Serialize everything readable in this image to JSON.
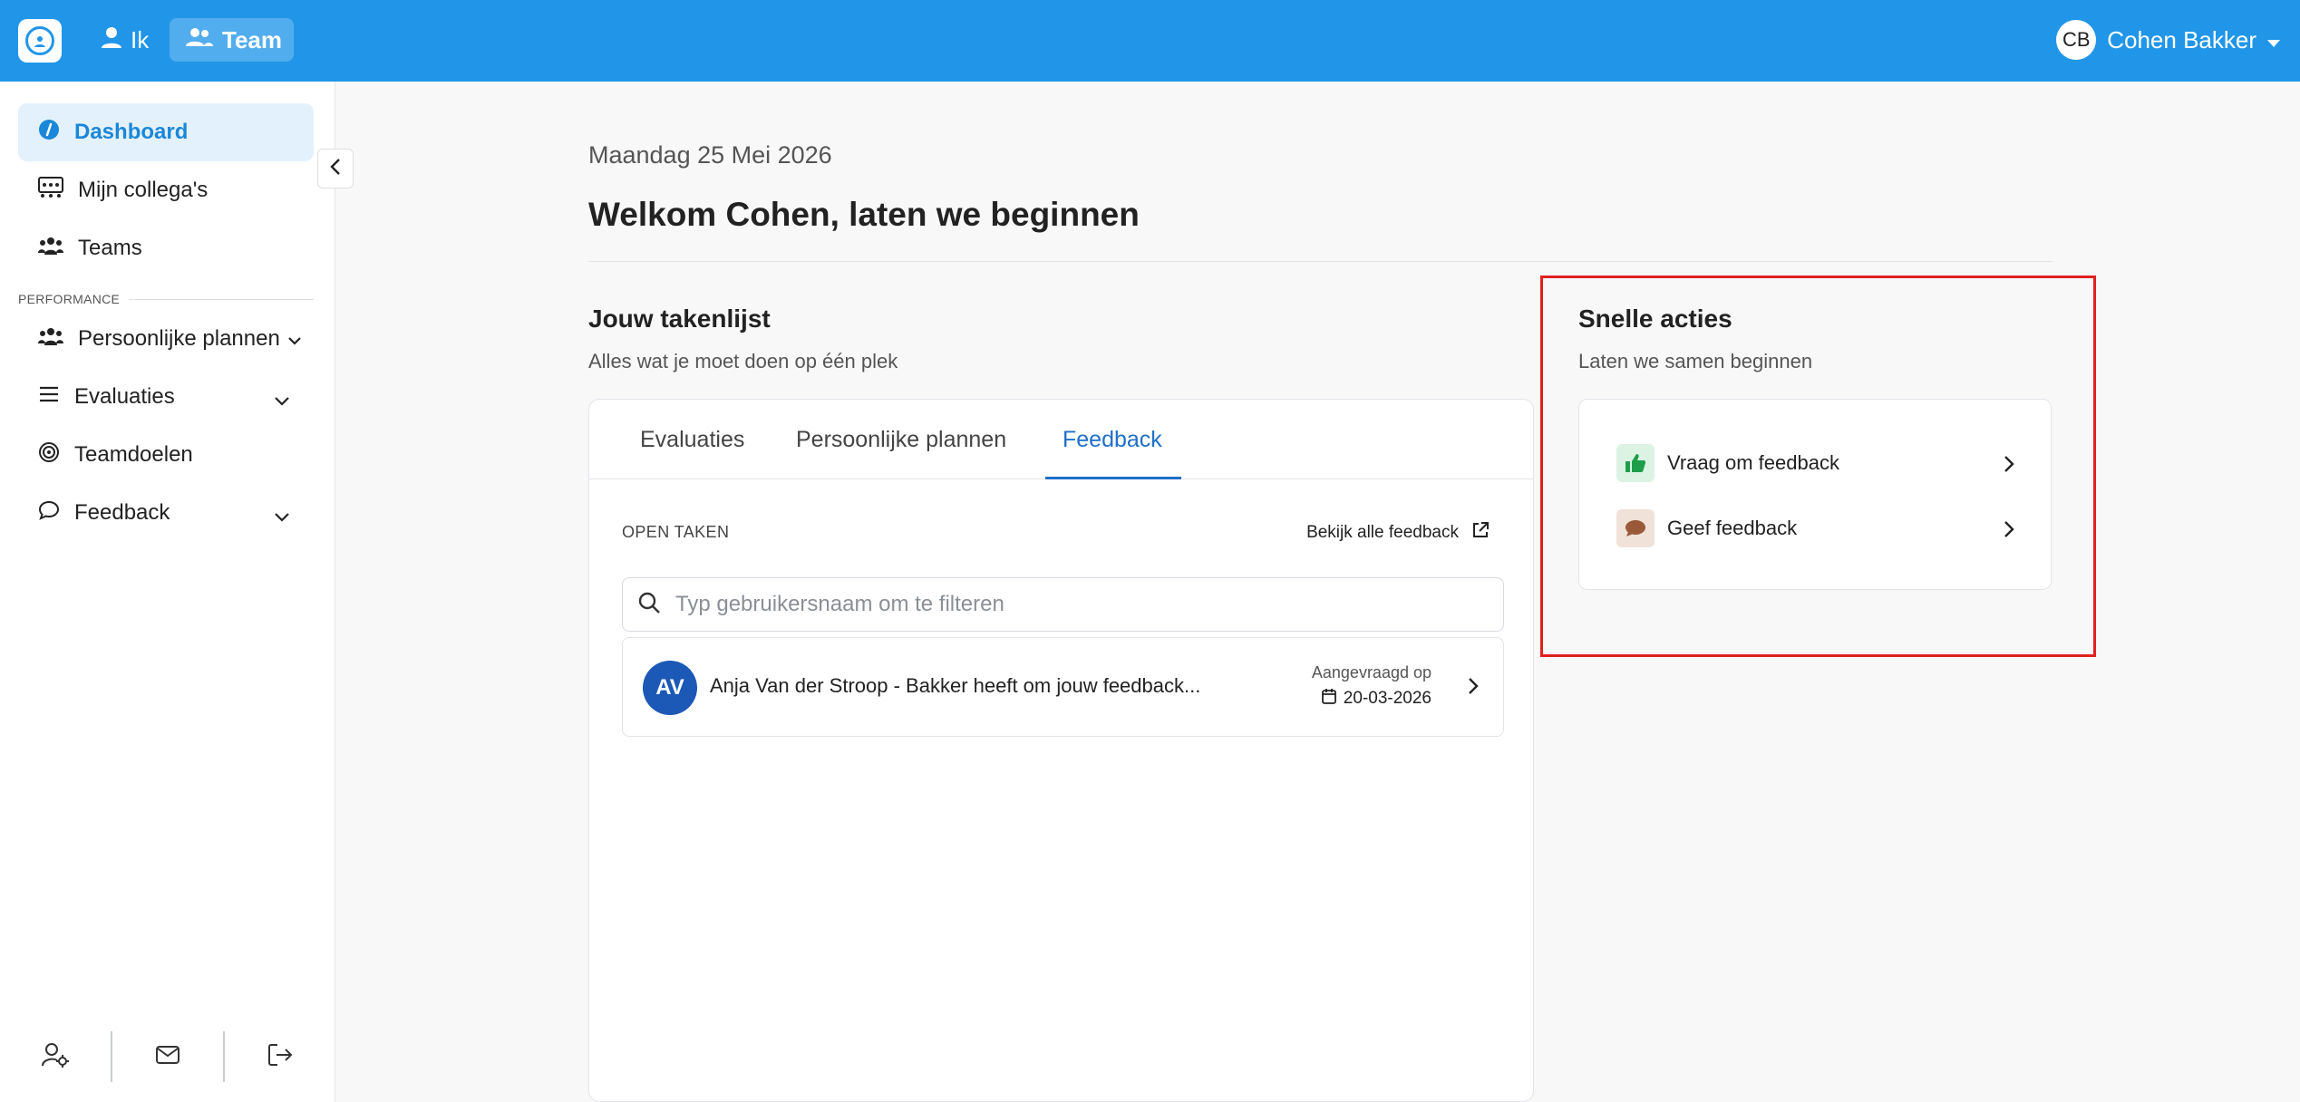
{
  "topbar": {
    "nav": [
      {
        "label": "Ik",
        "icon": "user-icon"
      },
      {
        "label": "Team",
        "icon": "users-icon",
        "active": true
      }
    ],
    "user": {
      "initials": "CB",
      "name": "Cohen Bakker"
    }
  },
  "sidebar": {
    "items": [
      {
        "label": "Dashboard",
        "icon": "dashboard-icon",
        "active": true
      },
      {
        "label": "Mijn collega's",
        "icon": "colleagues-icon"
      },
      {
        "label": "Teams",
        "icon": "teams-icon"
      }
    ],
    "section_label": "PERFORMANCE",
    "performance_items": [
      {
        "label": "Persoonlijke plannen",
        "icon": "plans-icon",
        "expandable": true
      },
      {
        "label": "Evaluaties",
        "icon": "list-icon",
        "expandable": true
      },
      {
        "label": "Teamdoelen",
        "icon": "target-icon",
        "expandable": false
      },
      {
        "label": "Feedback",
        "icon": "chat-icon",
        "expandable": true
      }
    ],
    "footer_icons": [
      "user-settings-icon",
      "mail-icon",
      "logout-icon"
    ]
  },
  "main": {
    "date": "Maandag 25 Mei 2026",
    "welcome": "Welkom Cohen, laten we beginnen",
    "tasklist": {
      "title": "Jouw takenlijst",
      "subtitle": "Alles wat je moet doen op één plek",
      "tabs": [
        {
          "label": "Evaluaties"
        },
        {
          "label": "Persoonlijke plannen"
        },
        {
          "label": "Feedback",
          "active": true
        }
      ],
      "open_tasks_label": "OPEN TAKEN",
      "view_all_label": "Bekijk alle feedback",
      "search_placeholder": "Typ gebruikersnaam om te filteren",
      "tasks": [
        {
          "initials": "AV",
          "text": "Anja Van der Stroop - Bakker heeft om jouw feedback...",
          "meta_label": "Aangevraagd op",
          "date": "20-03-2026"
        }
      ]
    },
    "quick_actions": {
      "title": "Snelle acties",
      "subtitle": "Laten we samen beginnen",
      "items": [
        {
          "label": "Vraag om feedback",
          "icon": "thumbs-up-icon",
          "color": "#1e9e4a",
          "bg": "#dcf3e3"
        },
        {
          "label": "Geef feedback",
          "icon": "speech-bubble-icon",
          "color": "#9a5a3a",
          "bg": "#f0e2d8"
        }
      ]
    }
  },
  "colors": {
    "primary": "#2196e8",
    "active_tab": "#1f6fc8",
    "highlight": "#e02020"
  }
}
